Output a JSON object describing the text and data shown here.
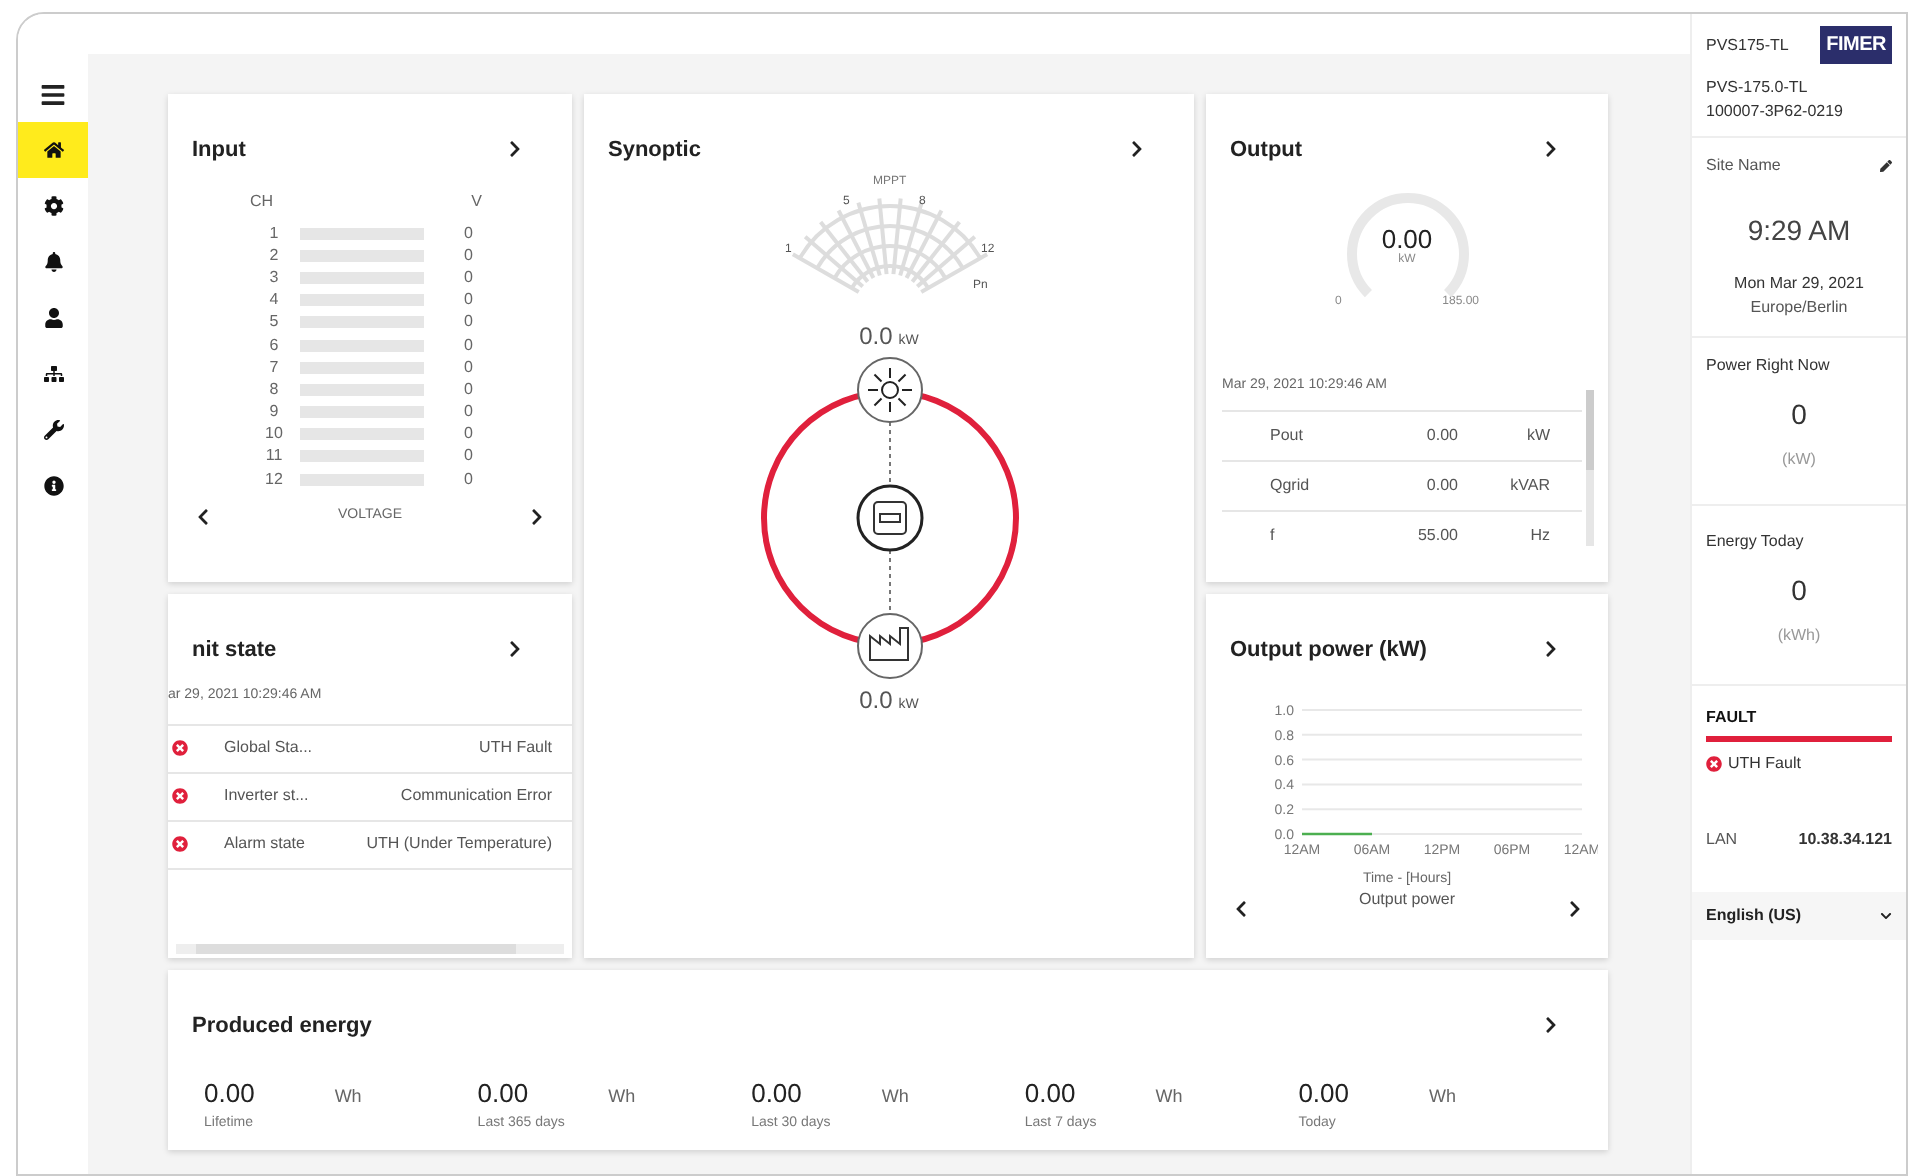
{
  "nav_items": [
    {
      "selected": true
    },
    {
      "selected": false
    },
    {
      "selected": false
    },
    {
      "selected": false
    },
    {
      "selected": false
    },
    {
      "selected": false
    },
    {
      "selected": false
    }
  ],
  "input": {
    "title": "Input",
    "col_ch": "CH",
    "col_v": "V",
    "channels": [
      {
        "ch": "1",
        "value": "0",
        "level": 0
      },
      {
        "ch": "2",
        "value": "0",
        "level": 0
      },
      {
        "ch": "3",
        "value": "0",
        "level": 0
      },
      {
        "ch": "4",
        "value": "0",
        "level": 0
      },
      {
        "ch": "5",
        "value": "0",
        "level": 0
      },
      {
        "ch": "6",
        "value": "0",
        "level": 0
      },
      {
        "ch": "7",
        "value": "0",
        "level": 0
      },
      {
        "ch": "8",
        "value": "0",
        "level": 0
      },
      {
        "ch": "9",
        "value": "0",
        "level": 0
      },
      {
        "ch": "10",
        "value": "0",
        "level": 0
      },
      {
        "ch": "11",
        "value": "0",
        "level": 0
      },
      {
        "ch": "12",
        "value": "0",
        "level": 0
      }
    ],
    "footer": "VOLTAGE"
  },
  "synoptic": {
    "title": "Synoptic",
    "fan_title": "MPPT",
    "fan_labels": [
      "1",
      "5",
      "8",
      "12"
    ],
    "fan_unit": "Pn",
    "pv_power": "0.0",
    "pv_unit": "kW",
    "grid_power": "0.0",
    "grid_unit": "kW"
  },
  "output": {
    "title": "Output",
    "gauge_value": "0.00",
    "gauge_unit": "kW",
    "gauge_min": "0",
    "gauge_max": "185.00",
    "timestamp": "Mar 29, 2021 10:29:46 AM",
    "rows": [
      {
        "name": "Pout",
        "value": "0.00",
        "unit": "kW"
      },
      {
        "name": "Qgrid",
        "value": "0.00",
        "unit": "kVAR"
      },
      {
        "name": "f",
        "value": "55.00",
        "unit": "Hz"
      }
    ]
  },
  "unit_state": {
    "title": "nit state",
    "timestamp": "ar 29, 2021 10:29:46 AM",
    "rows": [
      {
        "label": "Global Sta...",
        "value": "UTH Fault"
      },
      {
        "label": "Inverter st...",
        "value": "Communication Error"
      },
      {
        "label": "Alarm state",
        "value": "UTH (Under Temperature)"
      }
    ]
  },
  "output_power": {
    "title": "Output power (kW)",
    "chart_data": {
      "type": "line",
      "grid": true,
      "xlabel": "Time - [Hours]",
      "categories": [
        "12AM",
        "06AM",
        "12PM",
        "06PM",
        "12AM"
      ],
      "series": [
        {
          "name": "Output power",
          "color": "#4caf50",
          "values": [
            0,
            0,
            null,
            null,
            null
          ]
        }
      ],
      "ylim": [
        0,
        1
      ],
      "yticks": [
        {
          "value": 0,
          "label": "0.0"
        },
        {
          "value": 0.2,
          "label": "0.2"
        },
        {
          "value": 0.4,
          "label": "0.4"
        },
        {
          "value": 0.6,
          "label": "0.6"
        },
        {
          "value": 0.8,
          "label": "0.8"
        },
        {
          "value": 1,
          "label": "1.0"
        }
      ]
    }
  },
  "produced_energy": {
    "title": "Produced energy",
    "items": [
      {
        "value": "0.00",
        "unit": "Wh",
        "label": "Lifetime"
      },
      {
        "value": "0.00",
        "unit": "Wh",
        "label": "Last 365 days"
      },
      {
        "value": "0.00",
        "unit": "Wh",
        "label": "Last 30 days"
      },
      {
        "value": "0.00",
        "unit": "Wh",
        "label": "Last 7 days"
      },
      {
        "value": "0.00",
        "unit": "Wh",
        "label": "Today"
      }
    ]
  },
  "side_panel": {
    "model": "PVS175-TL",
    "logo": "FIMER",
    "device": "PVS-175.0-TL",
    "serial": "100007-3P62-0219",
    "site_name": "Site Name",
    "time": "9:29 AM",
    "date": "Mon Mar 29, 2021",
    "timezone": "Europe/Berlin",
    "power_label": "Power Right Now",
    "power_value": "0",
    "power_unit": "(kW)",
    "energy_label": "Energy Today",
    "energy_value": "0",
    "energy_unit": "(kWh)",
    "status_title": "FAULT",
    "fault": "UTH Fault",
    "lan_label": "LAN",
    "lan_value": "10.38.34.121",
    "language": "English (US)"
  }
}
